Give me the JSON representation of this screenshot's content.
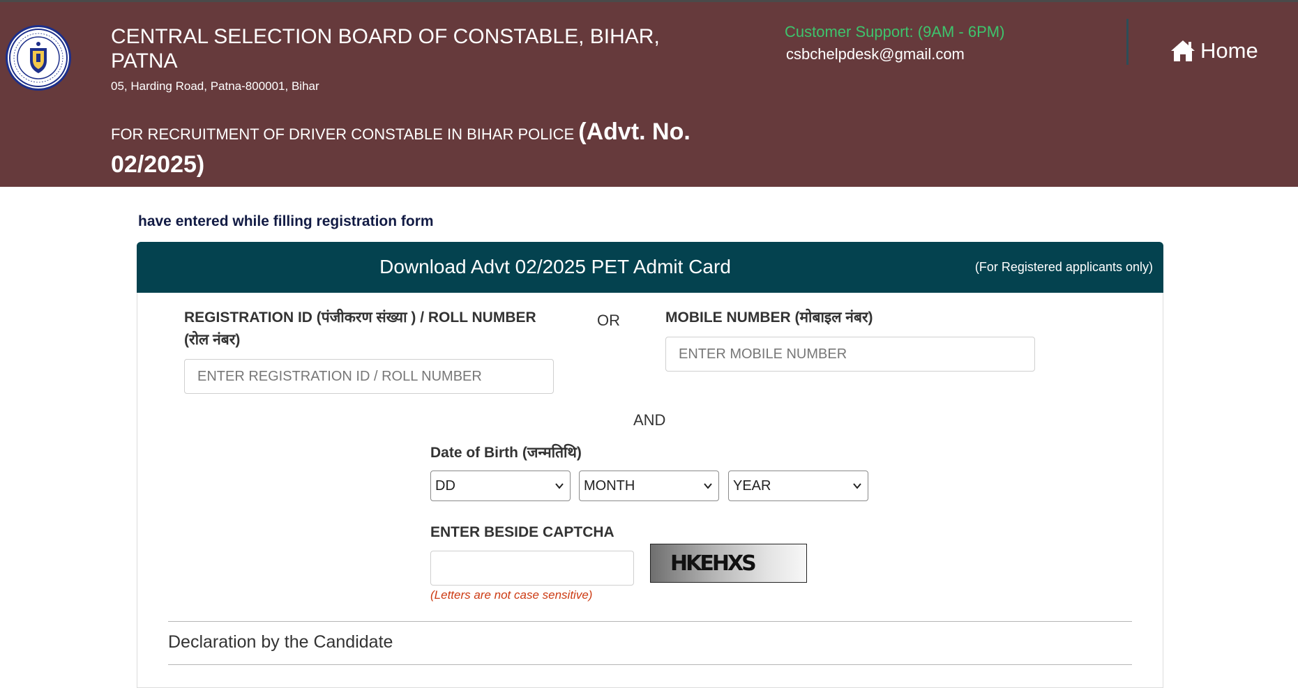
{
  "header": {
    "org_title": "CENTRAL SELECTION BOARD OF CONSTABLE, BIHAR, PATNA",
    "address": "05, Harding Road, Patna-800001, Bihar",
    "recruitment_prefix": "FOR RECRUITMENT OF DRIVER CONSTABLE IN BIHAR POLICE ",
    "recruitment_advt": "(Advt. No. 02/2025)",
    "support_label": "Customer Support: (9AM - 6PM)",
    "support_email": "csbchelpdesk@gmail.com",
    "home_label": "Home",
    "home_icon": "home-icon",
    "logo_icon": "emblem-seal-icon"
  },
  "instruction": "have entered while filling registration form",
  "card": {
    "title": "Download Advt 02/2025 PET Admit Card",
    "subtitle": "(For Registered applicants only)"
  },
  "form": {
    "registration_label": "REGISTRATION ID (पंजीकरण संख्या ) / ROLL NUMBER (रोल नंबर)",
    "registration_placeholder": "ENTER REGISTRATION ID / ROLL NUMBER",
    "or_text": "OR",
    "mobile_label": "MOBILE NUMBER (मोबाइल नंबर)",
    "mobile_placeholder": "ENTER MOBILE NUMBER",
    "and_text": "AND",
    "dob_label": "Date of Birth (जन्मतिथि)",
    "dob_day": "DD",
    "dob_month": "MONTH",
    "dob_year": "YEAR",
    "captcha_label": "ENTER BESIDE CAPTCHA",
    "captcha_value": "",
    "captcha_text": "HKEHXS",
    "captcha_hint": "(Letters are not case sensitive)"
  },
  "declaration": {
    "title": "Declaration by the Candidate"
  },
  "colors": {
    "header_bg": "#663a3c",
    "card_header_bg": "#04424f",
    "support_green": "#3ec46d",
    "hint_red": "#cc3a12"
  }
}
